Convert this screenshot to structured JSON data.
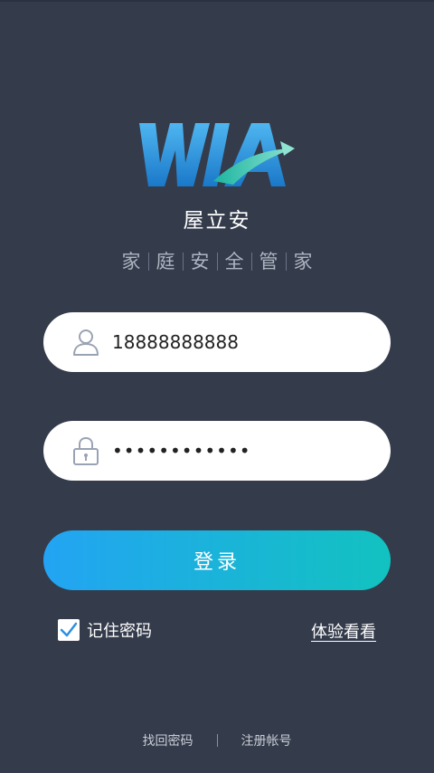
{
  "brand": {
    "logo_text": "WIA",
    "name": "屋立安",
    "slogan_chars": [
      "家",
      "庭",
      "安",
      "全",
      "管",
      "家"
    ]
  },
  "login_form": {
    "username_value": "18888888888",
    "password_value": "••••••••••••",
    "login_label": "登录",
    "remember_label": "记住密码",
    "remember_checked": true,
    "try_label": "体验看看"
  },
  "footer": {
    "forgot_label": "找回密码",
    "register_label": "注册帐号"
  },
  "colors": {
    "background": "#343b4b",
    "button_gradient_start": "#23a4f3",
    "button_gradient_end": "#12c2c0",
    "checkbox_check": "#2f8fe0"
  },
  "icons": {
    "username": "user-icon",
    "password": "lock-icon",
    "remember": "checkmark-icon"
  }
}
